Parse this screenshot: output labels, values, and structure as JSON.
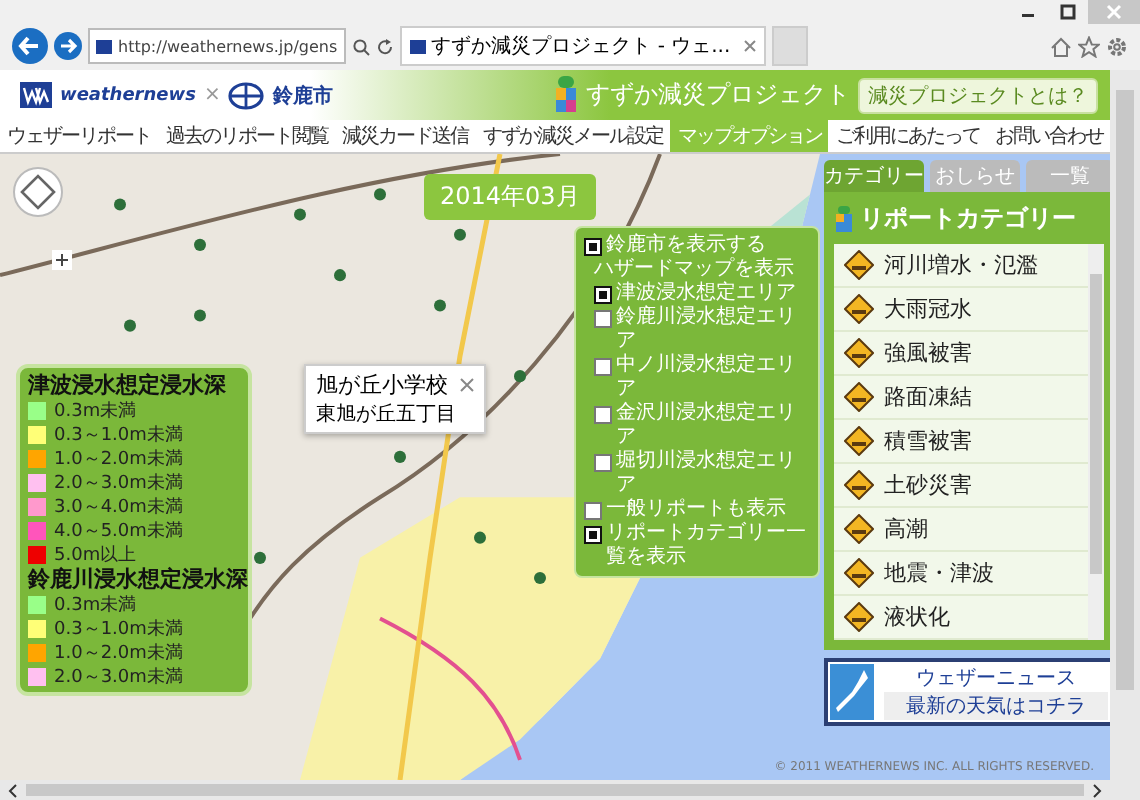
{
  "browser": {
    "url": "http://weathernews.jp/gens",
    "tab_title": "すずか減災プロジェクト - ウェ..."
  },
  "header": {
    "brand": "weathernews",
    "separator": "×",
    "city": "鈴鹿市",
    "title": "すずか減災プロジェクト",
    "about_button": "減災プロジェクトとは？"
  },
  "nav": [
    {
      "label": "ウェザーリポート",
      "selected": false
    },
    {
      "label": "過去のリポート閲覧",
      "selected": false
    },
    {
      "label": "減災カード送信",
      "selected": false
    },
    {
      "label": "すずか減災メール設定",
      "selected": false
    },
    {
      "label": "マップオプション",
      "selected": true
    },
    {
      "label": "ご利用にあたって",
      "selected": false
    },
    {
      "label": "お問い合わせ",
      "selected": false
    }
  ],
  "date_badge": "2014年03月",
  "map_options": [
    {
      "kind": "check",
      "label": "鈴鹿市を表示する",
      "checked": true
    },
    {
      "kind": "heading",
      "label": "ハザードマップを表示",
      "children": [
        {
          "kind": "check",
          "label": "津波浸水想定エリア",
          "checked": true
        },
        {
          "kind": "check",
          "label": "鈴鹿川浸水想定エリア",
          "checked": false
        },
        {
          "kind": "check",
          "label": "中ノ川浸水想定エリア",
          "checked": false
        },
        {
          "kind": "check",
          "label": "金沢川浸水想定エリア",
          "checked": false
        },
        {
          "kind": "check",
          "label": "堀切川浸水想定エリア",
          "checked": false
        }
      ]
    },
    {
      "kind": "check",
      "label": "一般リポートも表示",
      "checked": false
    },
    {
      "kind": "check",
      "label": "リポートカテゴリー一覧を表示",
      "checked": true
    }
  ],
  "map_popup": {
    "title": "旭が丘小学校",
    "subtitle": "東旭が丘五丁目"
  },
  "legend": [
    {
      "title": "津波浸水想定浸水深",
      "items": [
        {
          "label": "0.3m未満",
          "color": "#99ff88"
        },
        {
          "label": "0.3～1.0m未満",
          "color": "#ffff77"
        },
        {
          "label": "1.0～2.0m未満",
          "color": "#ffa500"
        },
        {
          "label": "2.0～3.0m未満",
          "color": "#ffc0f0"
        },
        {
          "label": "3.0～4.0m未満",
          "color": "#ff99cc"
        },
        {
          "label": "4.0～5.0m未満",
          "color": "#ff55bb"
        },
        {
          "label": "5.0m以上",
          "color": "#ee0000"
        }
      ]
    },
    {
      "title": "鈴鹿川浸水想定浸水深",
      "items": [
        {
          "label": "0.3m未満",
          "color": "#99ff88"
        },
        {
          "label": "0.3～1.0m未満",
          "color": "#ffff77"
        },
        {
          "label": "1.0～2.0m未満",
          "color": "#ffa500"
        },
        {
          "label": "2.0～3.0m未満",
          "color": "#ffc0f0"
        }
      ]
    }
  ],
  "side_tabs": [
    {
      "label": "カテゴリー",
      "selected": true
    },
    {
      "label": "おしらせ",
      "selected": false
    },
    {
      "label": "一覧",
      "selected": false
    }
  ],
  "category_title": "リポートカテゴリー",
  "categories": [
    {
      "label": "河川増水・氾濫"
    },
    {
      "label": "大雨冠水"
    },
    {
      "label": "強風被害"
    },
    {
      "label": "路面凍結"
    },
    {
      "label": "積雪被害"
    },
    {
      "label": "土砂災害"
    },
    {
      "label": "高潮"
    },
    {
      "label": "地震・津波"
    },
    {
      "label": "液状化"
    }
  ],
  "banner": {
    "line1": "ウェザーニュース",
    "line2": "最新の天気はコチラ"
  },
  "copyright": "© 2011 WEATHERNEWS INC. ALL RIGHTS RESERVED."
}
